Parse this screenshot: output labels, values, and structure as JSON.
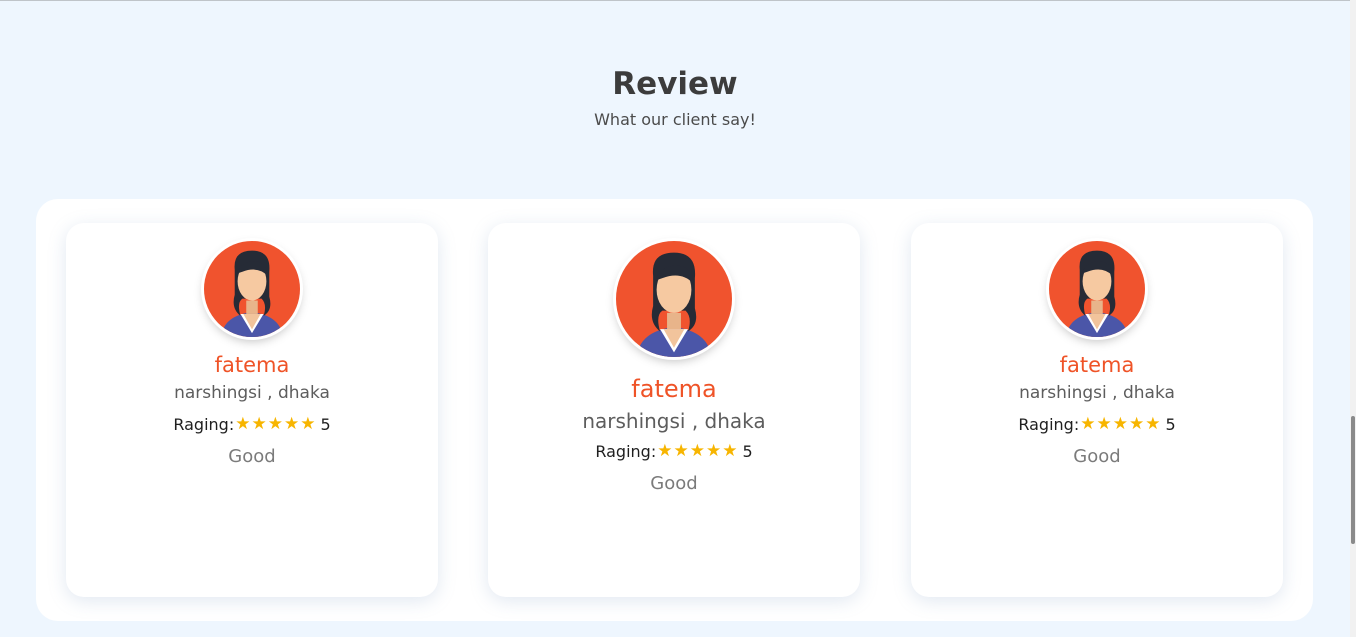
{
  "section": {
    "title": "Review",
    "subtitle": "What our client say!"
  },
  "reviews": [
    {
      "name": "fatema",
      "location": "narshingsi , dhaka",
      "rating_label": "Raging:",
      "rating": "5",
      "comment": "Good",
      "avatar_icon": "woman-avatar-icon"
    },
    {
      "name": "fatema",
      "location": "narshingsi , dhaka",
      "rating_label": "Raging:",
      "rating": "5",
      "comment": "Good",
      "avatar_icon": "woman-avatar-icon"
    },
    {
      "name": "fatema",
      "location": "narshingsi , dhaka",
      "rating_label": "Raging:",
      "rating": "5",
      "comment": "Good",
      "avatar_icon": "woman-avatar-icon"
    }
  ],
  "colors": {
    "accent": "#ef5327",
    "star": "#f7b500",
    "background": "#eef6fe"
  }
}
